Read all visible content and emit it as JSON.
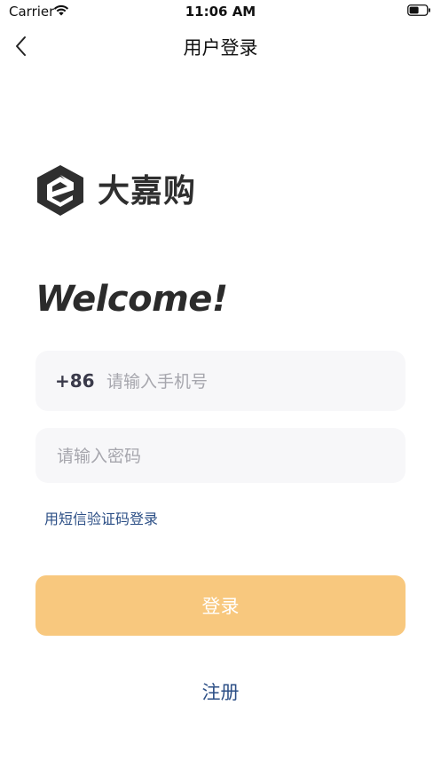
{
  "status_bar": {
    "carrier": "Carrier",
    "time": "11:06 AM",
    "wifi_icon": "wifi-icon",
    "battery_icon": "battery-icon"
  },
  "nav": {
    "back_icon": "chevron-left-icon",
    "title": "用户登录"
  },
  "logo": {
    "text": "大嘉购",
    "color": "#2f2f2f"
  },
  "welcome": "Welcome!",
  "phone_field": {
    "country_code": "+86",
    "placeholder": "请输入手机号",
    "value": ""
  },
  "password_field": {
    "placeholder": "请输入密码",
    "value": ""
  },
  "sms_login_link": "用短信验证码登录",
  "login_button": {
    "label": "登录",
    "color": "#f8c87e"
  },
  "register_link": "注册",
  "colors": {
    "link": "#2c4f86",
    "field_bg": "#f7f7f9"
  }
}
